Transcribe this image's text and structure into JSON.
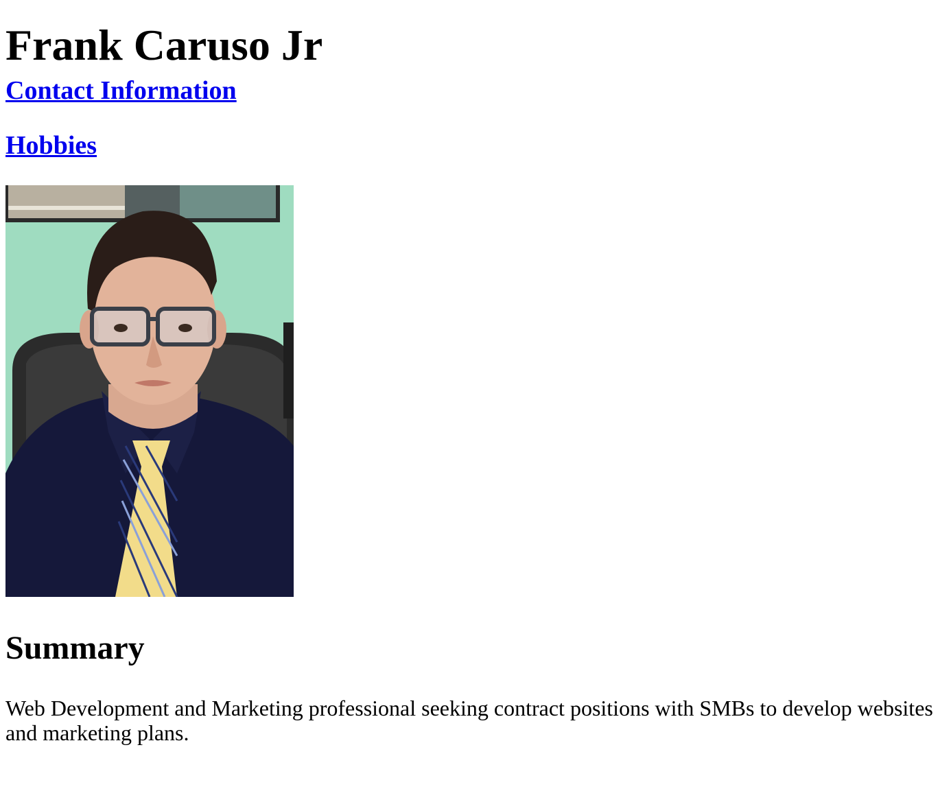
{
  "header": {
    "name": "Frank Caruso Jr"
  },
  "nav": {
    "contact_label": "Contact Information",
    "hobbies_label": "Hobbies"
  },
  "profile_photo": {
    "icon": "profile-photo",
    "wall_color": "#9fdcc0",
    "shirt_color": "#15183a",
    "tie_color": "#f2dc8a"
  },
  "summary": {
    "title": "Summary",
    "text": "Web Development and Marketing professional seeking contract positions with SMBs to develop websites and marketing plans."
  }
}
